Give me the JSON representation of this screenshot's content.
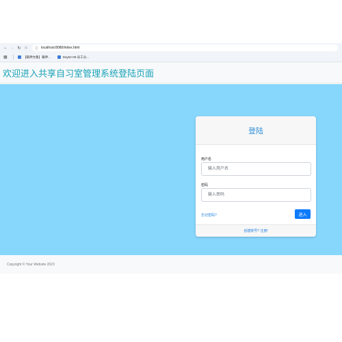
{
  "browser": {
    "url": "localhost:8080/index.html",
    "bookmarks": [
      {
        "label": "【箱神文集】箱神..."
      },
      {
        "label": "Day62-09-员工分..."
      }
    ]
  },
  "header": {
    "title": "欢迎进入共享自习室管理系统登陆页面"
  },
  "login": {
    "title": "登陆",
    "username_label": "用户名",
    "username_placeholder": "输入用户名",
    "password_label": "密码",
    "password_placeholder": "输入密码",
    "forgot_label": "忘记密码?",
    "submit_label": "进入",
    "register_label": "创建账号? 注册!"
  },
  "footer": {
    "copyright": "Copyright © Your Website 2023"
  },
  "colors": {
    "hero_bg": "#87d7fd",
    "title": "#17a2b8",
    "primary": "#0d7bfd",
    "link": "#1f7fdc"
  }
}
